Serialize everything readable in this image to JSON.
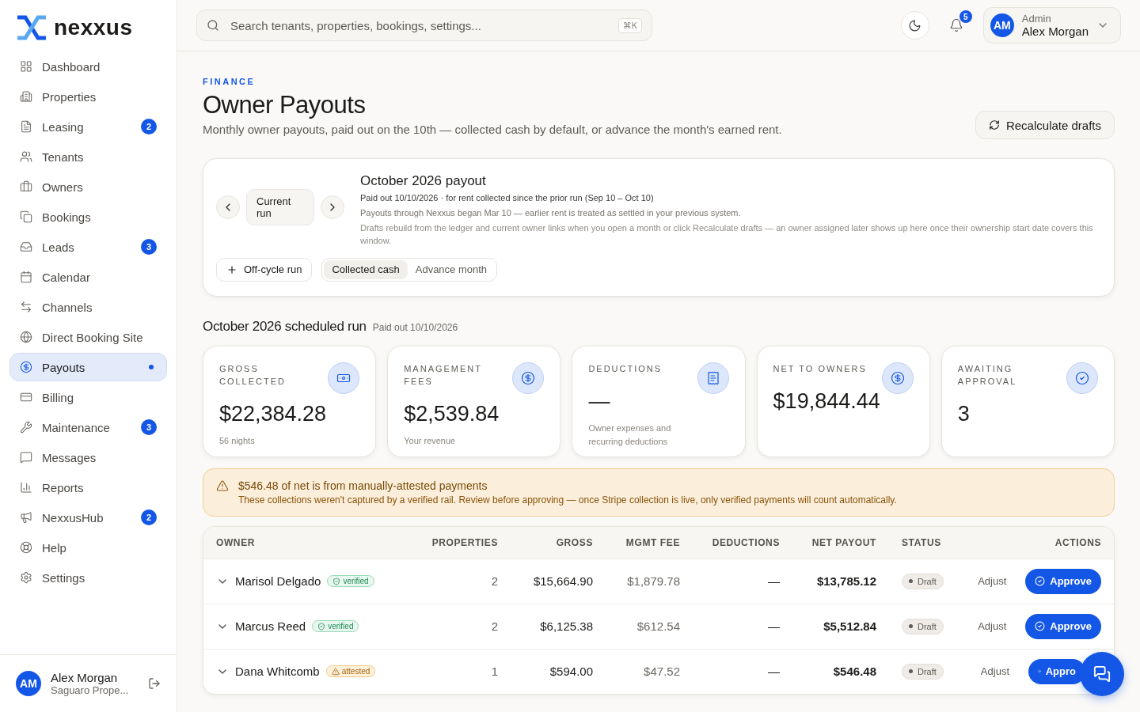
{
  "brand": {
    "name": "nexxus"
  },
  "sidebar": {
    "items": [
      {
        "label": "Dashboard",
        "selected": false
      },
      {
        "label": "Properties",
        "selected": false
      },
      {
        "label": "Leasing",
        "selected": false,
        "badge": "2"
      },
      {
        "label": "Tenants",
        "selected": false
      },
      {
        "label": "Owners",
        "selected": false
      },
      {
        "label": "Bookings",
        "selected": false
      },
      {
        "label": "Leads",
        "selected": false,
        "badge": "3"
      },
      {
        "label": "Calendar",
        "selected": false
      },
      {
        "label": "Channels",
        "selected": false
      },
      {
        "label": "Direct Booking Site",
        "selected": false
      },
      {
        "label": "Payouts",
        "selected": true
      },
      {
        "label": "Billing",
        "selected": false
      },
      {
        "label": "Maintenance",
        "selected": false,
        "badge": "3"
      },
      {
        "label": "Messages",
        "selected": false
      },
      {
        "label": "Reports",
        "selected": false
      },
      {
        "label": "NexxusHub",
        "selected": false,
        "badge": "2"
      },
      {
        "label": "Help",
        "selected": false
      },
      {
        "label": "Settings",
        "selected": false
      }
    ],
    "user": {
      "initials": "AM",
      "name": "Alex Morgan",
      "org": "Saguaro Prope..."
    }
  },
  "topbar": {
    "search": {
      "placeholder": "Search tenants, properties, bookings, settings...",
      "shortcut": "⌘K"
    },
    "notifications": "5",
    "user": {
      "initials": "AM",
      "role": "Admin",
      "name": "Alex Morgan"
    }
  },
  "page": {
    "eyebrow": "FINANCE",
    "title": "Owner Payouts",
    "subtitle": "Monthly owner payouts, paid out on the 10th — collected cash by default, or advance the month's earned rent.",
    "action": "Recalculate drafts"
  },
  "run_card": {
    "period": "Current run",
    "title": "October 2026 payout",
    "line_1": "Paid out 10/10/2026 · for rent collected since the prior run (Sep 10 – Oct 10)",
    "line_2": "Payouts through Nexxus began Mar 10 — earlier rent is treated as settled in your previous system.",
    "line_3": "Drafts rebuild from the ledger and current owner links when you open a month or click Recalculate drafts — an owner assigned later shows up here once their ownership start date covers this window.",
    "off_cycle": "Off-cycle run",
    "modes": [
      {
        "label": "Collected cash",
        "selected": true
      },
      {
        "label": "Advance month",
        "selected": false
      }
    ]
  },
  "run_heading": {
    "title": "October 2026 scheduled run",
    "note": "Paid out 10/10/2026"
  },
  "stats": [
    {
      "label": "GROSS COLLECTED",
      "value": "$22,384.28",
      "note": "56 nights"
    },
    {
      "label": "MANAGEMENT FEES",
      "value": "$2,539.84",
      "note": "Your revenue"
    },
    {
      "label": "DEDUCTIONS",
      "value": "—",
      "note": "Owner expenses and recurring deductions"
    },
    {
      "label": "NET TO OWNERS",
      "value": "$19,844.44"
    },
    {
      "label": "AWAITING APPROVAL",
      "value": "3"
    }
  ],
  "alert": {
    "title": "$546.48 of net is from manually-attested payments",
    "text": "These collections weren't captured by a verified rail. Review before approving — once Stripe collection is live, only verified payments will count automatically."
  },
  "table": {
    "columns": [
      "OWNER",
      "PROPERTIES",
      "GROSS",
      "MGMT FEE",
      "DEDUCTIONS",
      "NET PAYOUT",
      "STATUS",
      "ACTIONS"
    ],
    "rows": [
      {
        "owner": "Marisol Delgado",
        "tag": {
          "kind": "verified",
          "label": "verified"
        },
        "properties": "2",
        "gross": "$15,664.90",
        "fee": "$1,879.78",
        "deductions": "—",
        "net": "$13,785.12",
        "status": "Draft",
        "adjust": "Adjust",
        "approve": "Approve"
      },
      {
        "owner": "Marcus Reed",
        "tag": {
          "kind": "verified",
          "label": "verified"
        },
        "properties": "2",
        "gross": "$6,125.38",
        "fee": "$612.54",
        "deductions": "—",
        "net": "$5,512.84",
        "status": "Draft",
        "adjust": "Adjust",
        "approve": "Approve"
      },
      {
        "owner": "Dana Whitcomb",
        "tag": {
          "kind": "attested",
          "label": "attested"
        },
        "properties": "1",
        "gross": "$594.00",
        "fee": "$47.52",
        "deductions": "—",
        "net": "$546.48",
        "status": "Draft",
        "adjust": "Adjust",
        "approve": "Appro"
      }
    ]
  }
}
